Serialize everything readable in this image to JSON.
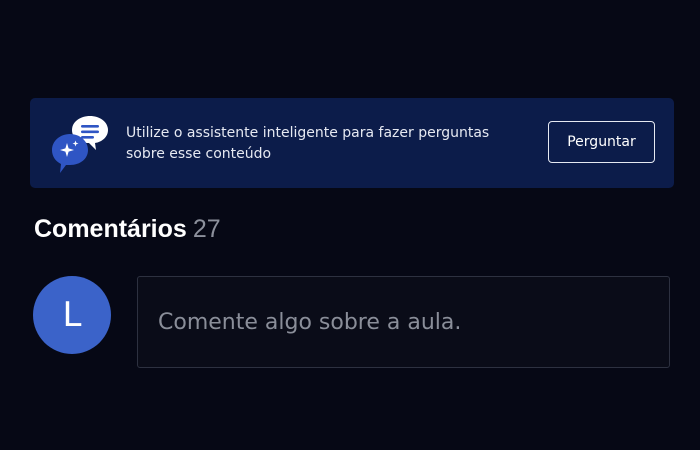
{
  "assistant_banner": {
    "icon": "chat-sparkle-icon",
    "message": "Utilize o assistente inteligente para fazer perguntas sobre esse conteúdo",
    "ask_button_label": "Perguntar"
  },
  "comments": {
    "title": "Comentários",
    "count": "27",
    "avatar_initial": "L",
    "input_placeholder": "Comente algo sobre a aula."
  },
  "colors": {
    "page_background": "#060815",
    "banner_background": "#0c1c4a",
    "avatar_background": "#3b63c9",
    "accent_blue": "#2f55c4"
  }
}
